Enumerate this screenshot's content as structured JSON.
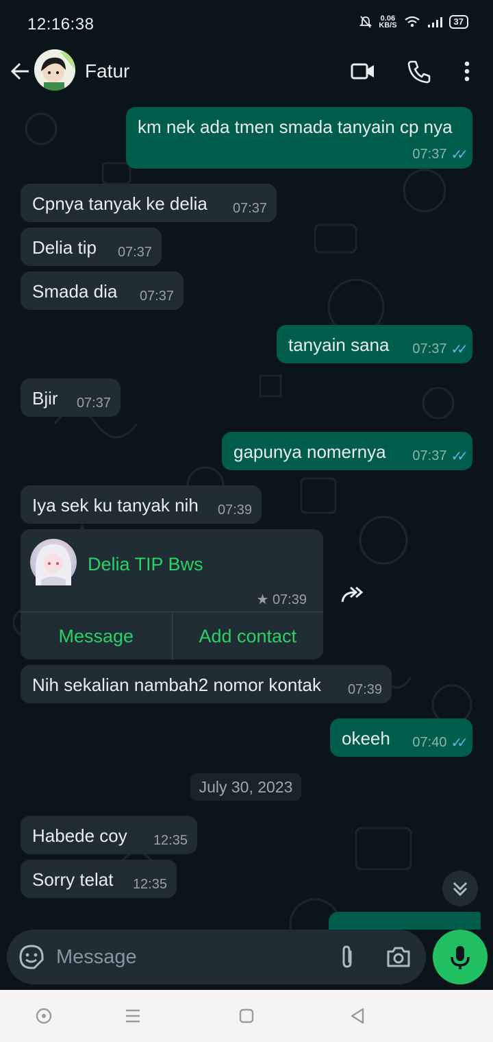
{
  "status_bar": {
    "time": "12:16:38",
    "net_speed_value": "0.06",
    "net_speed_unit": "KB/S",
    "battery": "37"
  },
  "header": {
    "contact_name": "Fatur",
    "icons": [
      "back-arrow-icon",
      "video-call-icon",
      "voice-call-icon",
      "more-vert-icon"
    ]
  },
  "messages": [
    {
      "dir": "out",
      "text": "km nek ada tmen smada tanyain cp nya",
      "time": "07:37",
      "status": "read"
    },
    {
      "dir": "in",
      "text": "Cpnya tanyak ke delia",
      "time": "07:37"
    },
    {
      "dir": "in",
      "text": "Delia tip",
      "time": "07:37"
    },
    {
      "dir": "in",
      "text": "Smada dia",
      "time": "07:37"
    },
    {
      "dir": "out",
      "text": "tanyain sana",
      "time": "07:37",
      "status": "read"
    },
    {
      "dir": "in",
      "text": "Bjir",
      "time": "07:37"
    },
    {
      "dir": "out",
      "text": "gapunya nomernya",
      "time": "07:37",
      "status": "read"
    },
    {
      "dir": "in",
      "text": "Iya sek ku tanyak nih",
      "time": "07:39"
    },
    {
      "dir": "in",
      "text": "Nih sekalian nambah2 nomor kontak",
      "time": "07:39"
    },
    {
      "dir": "out",
      "text": "okeeh",
      "time": "07:40",
      "status": "read"
    },
    {
      "dir": "in",
      "text": "Habede coy",
      "time": "12:35"
    },
    {
      "dir": "in",
      "text": "Sorry telat",
      "time": "12:35"
    }
  ],
  "contact_card": {
    "name": "Delia TIP Bws",
    "time": "07:39",
    "starred": true,
    "message_label": "Message",
    "add_contact_label": "Add contact"
  },
  "date_divider": "July 30, 2023",
  "composer": {
    "placeholder": "Message"
  },
  "colors": {
    "background": "#0b141a",
    "incoming_bubble": "#202c33",
    "outgoing_bubble": "#005c4b",
    "accent": "#25d366",
    "read_ticks": "#53bdeb"
  }
}
